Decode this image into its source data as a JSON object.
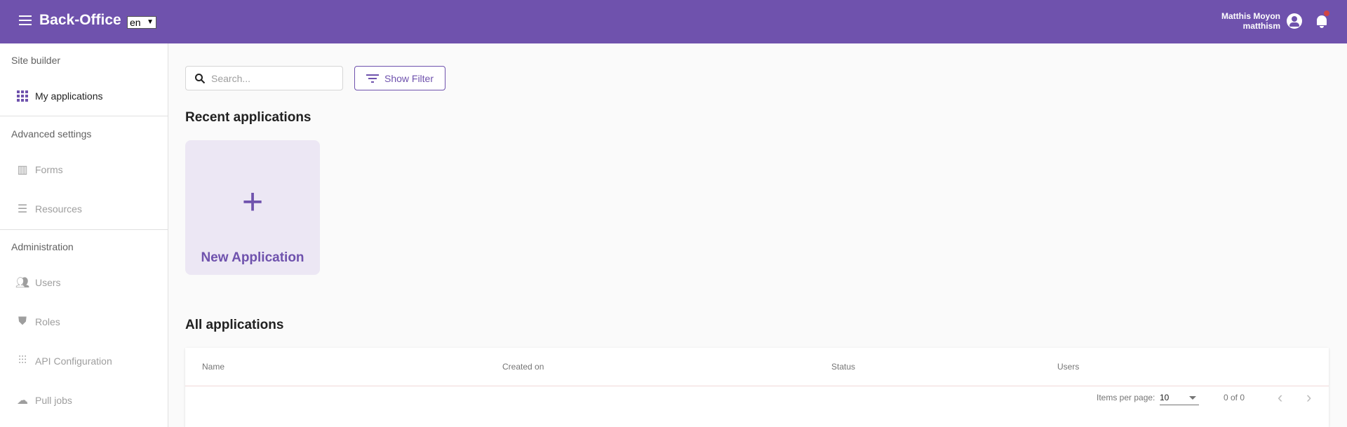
{
  "header": {
    "title": "Back-Office",
    "language": "en",
    "user_name": "Matthis Moyon",
    "user_login": "matthism",
    "accent": "#6f52ad",
    "notification_color": "#d04444"
  },
  "sidebar": {
    "sections": [
      "Site builder",
      "Advanced settings",
      "Administration"
    ],
    "items": [
      {
        "label": "My applications",
        "icon": "apps-grid-icon"
      },
      {
        "label": "Forms",
        "icon": "bar-chart-icon"
      },
      {
        "label": "Resources",
        "icon": "storage-icon"
      },
      {
        "label": "Users",
        "icon": "people-icon"
      },
      {
        "label": "Roles",
        "icon": "shield-user-icon"
      },
      {
        "label": "API Configuration",
        "icon": "sliders-icon"
      },
      {
        "label": "Pull jobs",
        "icon": "cloud-download-icon"
      }
    ]
  },
  "main": {
    "search_placeholder": "Search...",
    "filter_label": "Show Filter",
    "recent_title": "Recent applications",
    "new_app_label": "New Application",
    "all_title": "All applications",
    "columns": [
      "Name",
      "Created on",
      "Status",
      "Users"
    ],
    "items_per_page_label": "Items per page:",
    "items_per_page": "10",
    "range": "0 of 0"
  }
}
